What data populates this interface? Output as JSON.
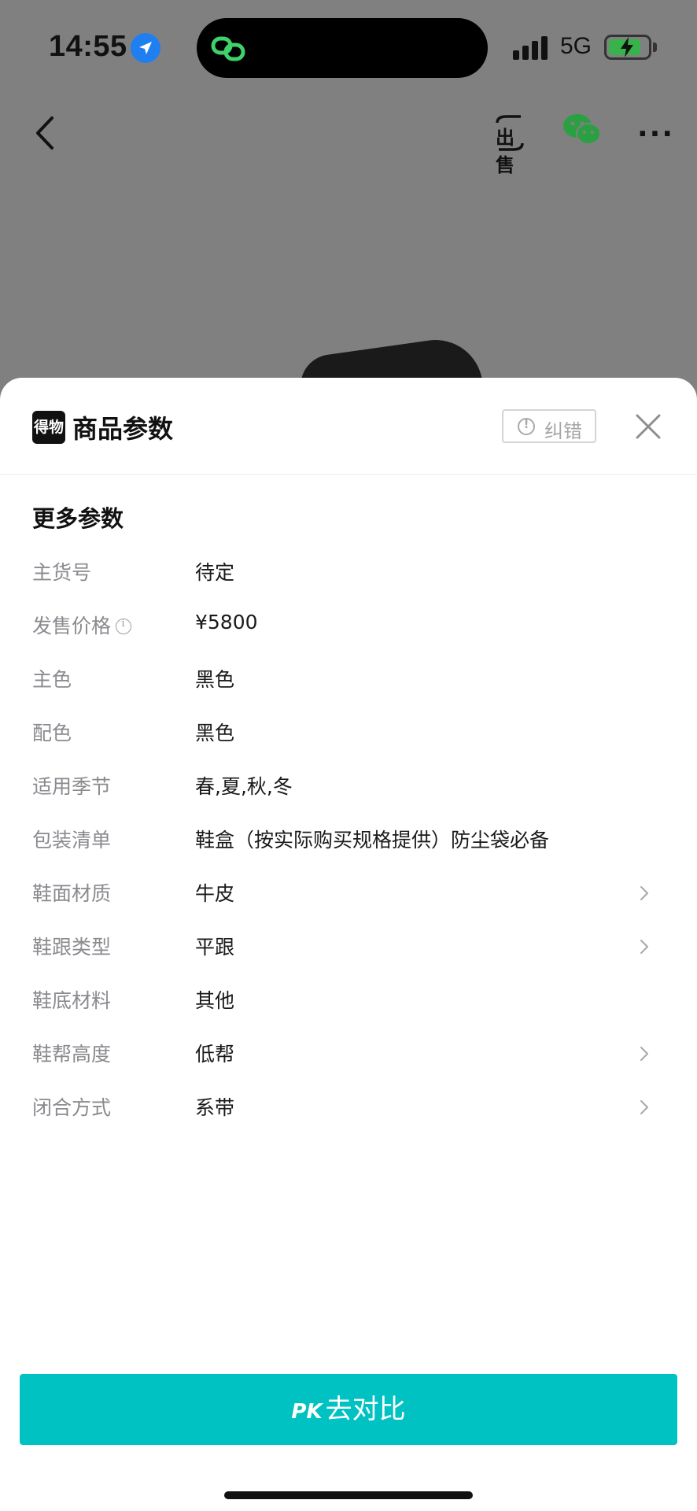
{
  "status_bar": {
    "time": "14:55",
    "network": "5G"
  },
  "nav": {
    "sell_label": "出售"
  },
  "sheet": {
    "brand_logo_text": "得物",
    "title": "商品参数",
    "report_label": "纠错",
    "section_title": "更多参数",
    "params": [
      {
        "label": "主货号",
        "value": "待定",
        "has_info": false,
        "has_arrow": false
      },
      {
        "label": "发售价格",
        "value": "¥5800",
        "has_info": true,
        "has_arrow": false
      },
      {
        "label": "主色",
        "value": "黑色",
        "has_info": false,
        "has_arrow": false
      },
      {
        "label": "配色",
        "value": "黑色",
        "has_info": false,
        "has_arrow": false
      },
      {
        "label": "适用季节",
        "value": "春,夏,秋,冬",
        "has_info": false,
        "has_arrow": false
      },
      {
        "label": "包装清单",
        "value": "鞋盒（按实际购买规格提供）防尘袋必备",
        "has_info": false,
        "has_arrow": false
      },
      {
        "label": "鞋面材质",
        "value": "牛皮",
        "has_info": false,
        "has_arrow": true
      },
      {
        "label": "鞋跟类型",
        "value": "平跟",
        "has_info": false,
        "has_arrow": true
      },
      {
        "label": "鞋底材料",
        "value": "其他",
        "has_info": false,
        "has_arrow": false
      },
      {
        "label": "鞋帮高度",
        "value": "低帮",
        "has_info": false,
        "has_arrow": true
      },
      {
        "label": "闭合方式",
        "value": "系带",
        "has_info": false,
        "has_arrow": true
      }
    ]
  },
  "pk_button": {
    "prefix": "PK",
    "label": "去对比"
  },
  "colors": {
    "accent": "#01c2c3",
    "label_gray": "#8a8a8f",
    "overlay": "#808080"
  }
}
